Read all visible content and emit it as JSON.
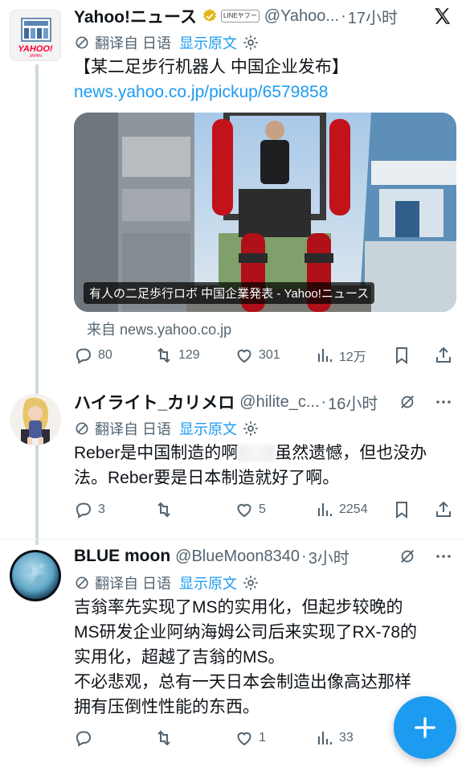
{
  "tweets": [
    {
      "name": "Yahoo!ニュース",
      "affiliate_badge": "LINEヤフー",
      "handle": "@Yahoo...",
      "time": "17小时",
      "avatar_text": "YAHOO!",
      "avatar_subtext": "JAPAN",
      "translate": {
        "label": "翻译自 日语",
        "show": "显示原文"
      },
      "text": "【某二足步行机器人 中国企业发布】",
      "link": "news.yahoo.co.jp/pickup/6579858",
      "card_caption": "有人の二足歩行ロボ 中国企業発表 - Yahoo!ニュース",
      "from": "来自 news.yahoo.co.jp",
      "stats": {
        "replies": "80",
        "retweets": "129",
        "likes": "301",
        "views": "12万"
      }
    },
    {
      "name": "ハイライト_カリメロ",
      "handle": "@hilite_c...",
      "time": "16小时",
      "translate": {
        "label": "翻译自 日语",
        "show": "显示原文"
      },
      "text_line1_a": "Reber是中国制造的啊",
      "text_line1_b": "虽然遗憾，但也没办",
      "text_line2": "法。Reber要是日本制造就好了啊。",
      "stats": {
        "replies": "3",
        "retweets": "",
        "likes": "5",
        "views": "2254"
      }
    },
    {
      "name": "BLUE moon",
      "handle": "@BlueMoon8340",
      "time": "3小时",
      "translate": {
        "label": "翻译自 日语",
        "show": "显示原文"
      },
      "lines": [
        "吉翁率先实现了MS的实用化，但起步较晚的",
        "MS研发企业阿纳海姆公司后来实现了RX-78的",
        "实用化，超越了吉翁的MS。",
        "不必悲观，总有一天日本会制造出像高达那样",
        "拥有压倒性性能的东西。"
      ],
      "stats": {
        "replies": "",
        "retweets": "",
        "likes": "1",
        "views": "33"
      }
    }
  ],
  "fab_icon": "plus-icon",
  "colors": {
    "accent": "#1d9bf0",
    "muted": "#536471",
    "text": "#0f1419"
  }
}
